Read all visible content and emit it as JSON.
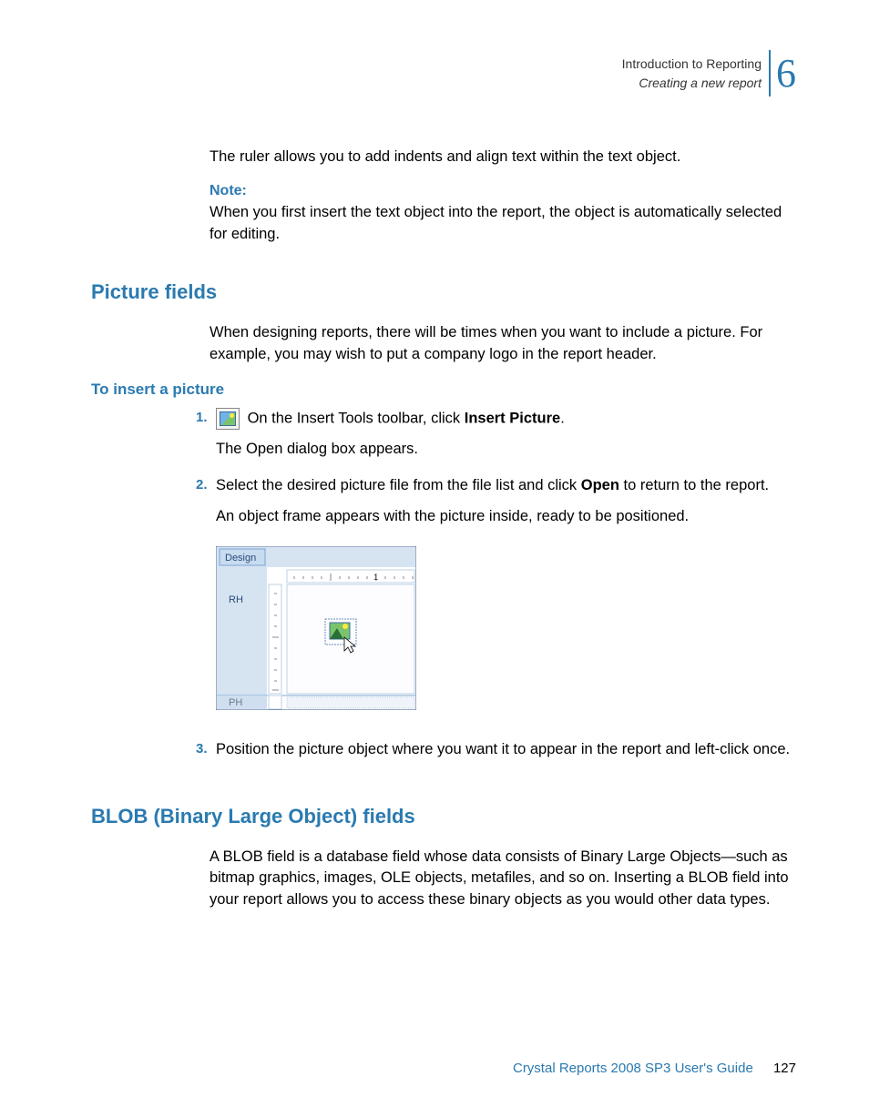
{
  "header": {
    "topic": "Introduction to Reporting",
    "subtopic": "Creating a new report",
    "chapter_number": "6"
  },
  "paragraphs": {
    "ruler_info": "The ruler allows you to add indents and align text within the text object.",
    "note_label": "Note:",
    "note_text": "When you first insert the text object into the report, the object is automatically selected for editing."
  },
  "sections": {
    "picture_fields": {
      "heading": "Picture fields",
      "intro": "When designing reports, there will be times when you want to include a picture. For example, you may wish to put a company logo in the report header.",
      "subheading": "To insert a picture",
      "steps": [
        {
          "num": "1.",
          "text_before": " On the Insert Tools toolbar, click ",
          "bold": "Insert Picture",
          "text_after": ".",
          "followup": "The Open dialog box appears."
        },
        {
          "num": "2.",
          "text_before": "Select the desired picture file from the file list and click ",
          "bold": "Open",
          "text_after": " to return to the report.",
          "followup": "An object frame appears with the picture inside, ready to be positioned."
        },
        {
          "num": "3.",
          "text_before": "Position the picture object where you want it to appear in the report and left-click once.",
          "bold": "",
          "text_after": "",
          "followup": ""
        }
      ],
      "screenshot": {
        "tab": "Design",
        "rh_label": "RH",
        "ph_label": "PH",
        "ruler_mark": "1"
      }
    },
    "blob_fields": {
      "heading": "BLOB (Binary Large Object) fields",
      "intro": "A BLOB field is a database field whose data consists of Binary Large Objects—such as bitmap graphics, images, OLE objects, metafiles, and so on. Inserting a BLOB field into your report allows you to access these binary objects as you would other data types."
    }
  },
  "footer": {
    "title": "Crystal Reports 2008 SP3 User's Guide",
    "page": "127"
  }
}
